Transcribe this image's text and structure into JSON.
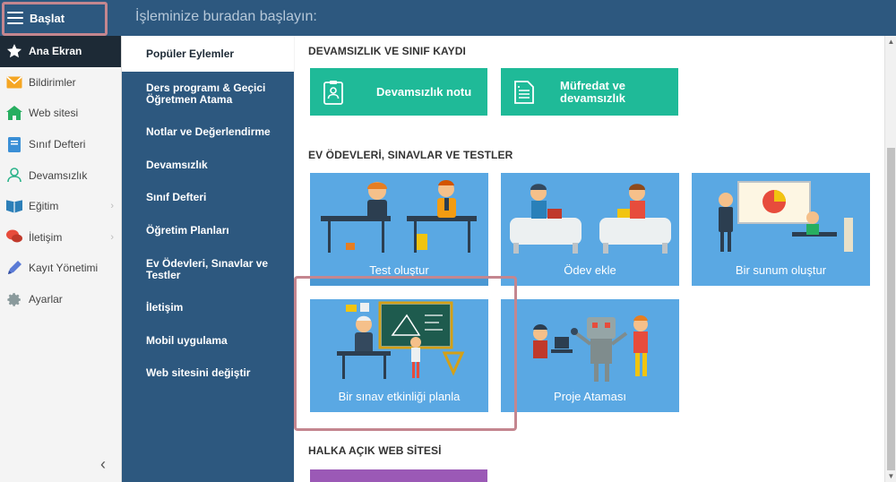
{
  "topbar": {
    "start_label": "Başlat",
    "title": "İşleminize buradan başlayın:"
  },
  "sidebar": {
    "items": [
      {
        "label": "Ana Ekran",
        "icon": "star-icon",
        "active": true
      },
      {
        "label": "Bildirimler",
        "icon": "envelope-icon"
      },
      {
        "label": "Web sitesi",
        "icon": "home-icon"
      },
      {
        "label": "Sınıf Defteri",
        "icon": "notebook-icon"
      },
      {
        "label": "Devamsızlık",
        "icon": "person-icon"
      },
      {
        "label": "Eğitim",
        "icon": "book-icon",
        "chevron": true
      },
      {
        "label": "İletişim",
        "icon": "chat-icon",
        "chevron": true
      },
      {
        "label": "Kayıt Yönetimi",
        "icon": "pen-icon"
      },
      {
        "label": "Ayarlar",
        "icon": "gear-icon"
      }
    ]
  },
  "categories": [
    "Popüler Eylemler",
    "Ders programı & Geçici Öğretmen Atama",
    "Notlar ve Değerlendirme",
    "Devamsızlık",
    "Sınıf Defteri",
    "Öğretim Planları",
    "Ev Ödevleri, Sınavlar ve Testler",
    "İletişim",
    "Mobil uygulama",
    "Web sitesini değiştir"
  ],
  "sections": {
    "attendance": {
      "title": "DEVAMSIZLIK VE SINIF KAYDI",
      "cards": [
        "Devamsızlık notu",
        "Müfredat ve devamsızlık"
      ]
    },
    "homework": {
      "title": "EV ÖDEVLERİ, SINAVLAR VE TESTLER",
      "cards": [
        "Test oluştur",
        "Ödev ekle",
        "Bir sunum oluştur",
        "Bir sınav etkinliği planla",
        "Proje Ataması"
      ]
    },
    "public_site": {
      "title": "HALKA AÇIK WEB SİTESİ"
    }
  },
  "colors": {
    "topbar": "#2d587f",
    "green_card": "#1fba98",
    "blue_card": "#5aa8e3",
    "highlight": "#c4868f"
  }
}
